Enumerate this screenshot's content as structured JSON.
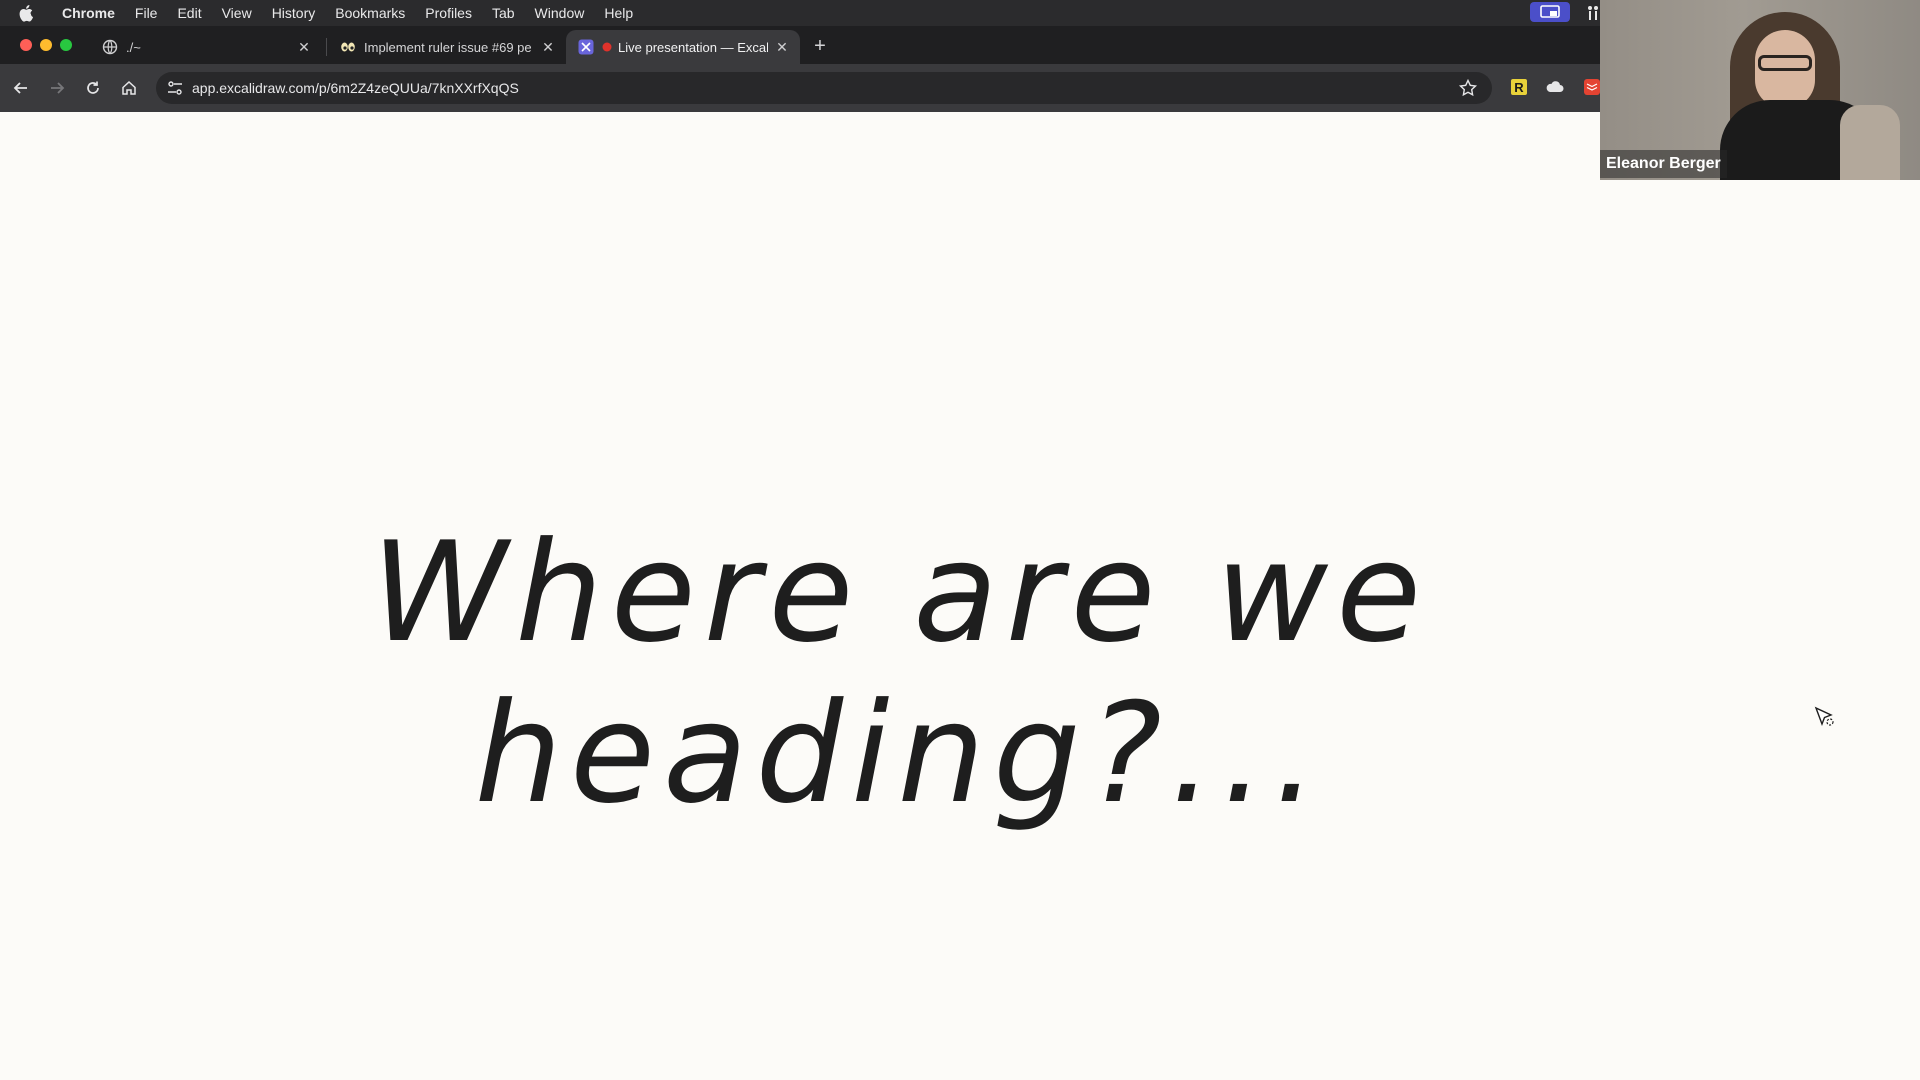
{
  "menubar": {
    "app_name": "Chrome",
    "items": [
      "File",
      "Edit",
      "View",
      "History",
      "Bookmarks",
      "Profiles",
      "Tab",
      "Window",
      "Help"
    ]
  },
  "tabs": [
    {
      "title": "./~",
      "favicon": "globe-icon"
    },
    {
      "title": "Implement ruler issue #69 pe",
      "favicon": "eyes-emoji-icon"
    },
    {
      "title": "Live presentation — Excali",
      "favicon": "excalidraw-icon",
      "active": true,
      "recording_indicator": "red-dot-icon"
    }
  ],
  "toolbar": {
    "url": "app.excalidraw.com/p/6m2Z4zeQUUa/7knXXrfXqQS"
  },
  "slide": {
    "text": "Where are we heading?..."
  },
  "webcam": {
    "name": "Eleanor Berger"
  },
  "colors": {
    "canvas_bg": "#fcfbf8",
    "text": "#1e1e1e",
    "menubar_bg": "#2b2b2d",
    "toolbar_bg": "#3a3a3d",
    "screen_share_accent": "#4b4fc9"
  }
}
